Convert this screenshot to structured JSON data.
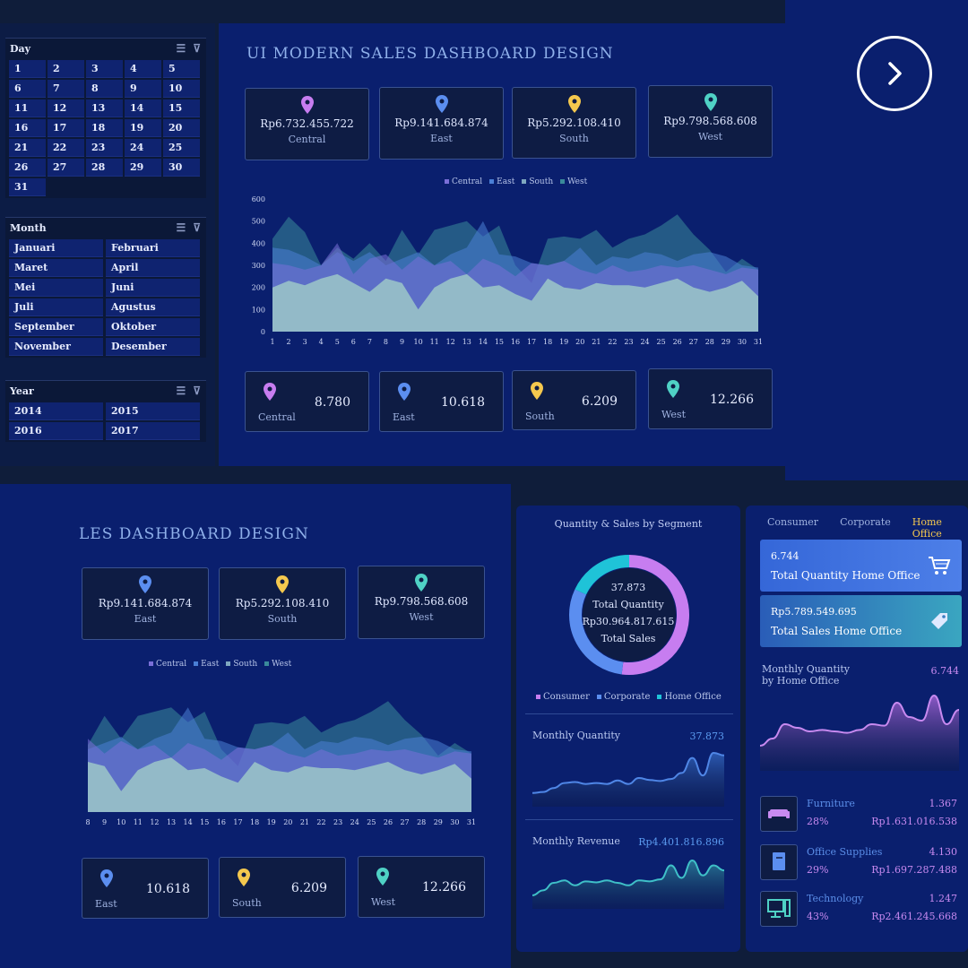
{
  "slicers": {
    "day": {
      "title": "Day",
      "items": [
        "1",
        "2",
        "3",
        "4",
        "5",
        "6",
        "7",
        "8",
        "9",
        "10",
        "11",
        "12",
        "13",
        "14",
        "15",
        "16",
        "17",
        "18",
        "19",
        "20",
        "21",
        "22",
        "23",
        "24",
        "25",
        "26",
        "27",
        "28",
        "29",
        "30",
        "31"
      ]
    },
    "month": {
      "title": "Month",
      "items": [
        "Januari",
        "Februari",
        "Maret",
        "April",
        "Mei",
        "Juni",
        "Juli",
        "Agustus",
        "September",
        "Oktober",
        "November",
        "Desember"
      ]
    },
    "year": {
      "title": "Year",
      "items": [
        "2014",
        "2015",
        "2016",
        "2017"
      ]
    }
  },
  "top": {
    "title": "UI MODERN SALES DASHBOARD DESIGN",
    "sales_cards": [
      {
        "amount": "Rp6.732.455.722",
        "region": "Central",
        "color": "#c77df0"
      },
      {
        "amount": "Rp9.141.684.874",
        "region": "East",
        "color": "#5b8ef0"
      },
      {
        "amount": "Rp5.292.108.410",
        "region": "South",
        "color": "#f4c84e"
      },
      {
        "amount": "Rp9.798.568.608",
        "region": "West",
        "color": "#4fd1c5"
      }
    ],
    "qty_cards": [
      {
        "region": "Central",
        "qty": "8.780",
        "color": "#c77df0"
      },
      {
        "region": "East",
        "qty": "10.618",
        "color": "#5b8ef0"
      },
      {
        "region": "South",
        "qty": "6.209",
        "color": "#f4c84e"
      },
      {
        "region": "West",
        "qty": "12.266",
        "color": "#4fd1c5"
      }
    ]
  },
  "bottom": {
    "title": "LES DASHBOARD DESIGN",
    "sales_cards": [
      {
        "amount": "Rp9.141.684.874",
        "region": "East",
        "color": "#5b8ef0"
      },
      {
        "amount": "Rp5.292.108.410",
        "region": "South",
        "color": "#f4c84e"
      },
      {
        "amount": "Rp9.798.568.608",
        "region": "West",
        "color": "#4fd1c5"
      }
    ],
    "qty_cards": [
      {
        "region": "East",
        "qty": "10.618",
        "color": "#5b8ef0"
      },
      {
        "region": "South",
        "qty": "6.209",
        "color": "#f4c84e"
      },
      {
        "region": "West",
        "qty": "12.266",
        "color": "#4fd1c5"
      }
    ]
  },
  "chart_data": [
    {
      "type": "area",
      "legend": [
        "Central",
        "East",
        "South",
        "West"
      ],
      "x": [
        1,
        2,
        3,
        4,
        5,
        6,
        7,
        8,
        9,
        10,
        11,
        12,
        13,
        14,
        15,
        16,
        17,
        18,
        19,
        20,
        21,
        22,
        23,
        24,
        25,
        26,
        27,
        28,
        29,
        30,
        31
      ],
      "ylim": [
        0,
        600
      ],
      "yticks": [
        0,
        100,
        200,
        300,
        400,
        500,
        600
      ],
      "series": [
        {
          "name": "Central",
          "color": "#7a6fd8",
          "values": [
            310,
            300,
            280,
            300,
            400,
            260,
            330,
            350,
            280,
            340,
            300,
            320,
            260,
            330,
            300,
            250,
            310,
            300,
            320,
            280,
            260,
            300,
            270,
            280,
            300,
            290,
            300,
            280,
            260,
            290,
            280
          ]
        },
        {
          "name": "East",
          "color": "#4a7fd6",
          "values": [
            380,
            370,
            340,
            300,
            360,
            320,
            360,
            300,
            330,
            360,
            300,
            350,
            380,
            500,
            350,
            340,
            310,
            300,
            320,
            380,
            300,
            340,
            330,
            360,
            350,
            320,
            350,
            360,
            340,
            300,
            290
          ]
        },
        {
          "name": "South",
          "color": "#7fa8c0",
          "values": [
            200,
            230,
            210,
            240,
            260,
            220,
            180,
            240,
            220,
            100,
            200,
            240,
            260,
            200,
            210,
            170,
            140,
            240,
            200,
            190,
            220,
            210,
            210,
            200,
            220,
            240,
            200,
            180,
            200,
            230,
            160
          ]
        },
        {
          "name": "West",
          "color": "#3a8a9a",
          "values": [
            420,
            520,
            450,
            300,
            380,
            330,
            400,
            320,
            460,
            350,
            460,
            480,
            500,
            430,
            480,
            300,
            220,
            420,
            430,
            420,
            460,
            380,
            420,
            440,
            480,
            530,
            440,
            370,
            270,
            330,
            280
          ]
        }
      ]
    },
    {
      "type": "pie",
      "title": "Quantity & Sales by Segment",
      "labels": [
        "Consumer",
        "Corporate",
        "Home Office"
      ],
      "colors": [
        "#c77df0",
        "#5b8ef0",
        "#1fc3d8"
      ],
      "values": [
        52,
        30,
        18
      ]
    },
    {
      "type": "area",
      "title": "Monthly Quantity",
      "values": [
        20,
        22,
        30,
        40,
        42,
        38,
        40,
        38,
        45,
        38,
        50,
        46,
        44,
        48,
        60,
        90,
        55,
        100,
        95
      ]
    },
    {
      "type": "area",
      "title": "Monthly Revenue",
      "values": [
        20,
        30,
        45,
        50,
        40,
        48,
        46,
        50,
        45,
        40,
        50,
        48,
        52,
        80,
        55,
        90,
        60,
        80,
        70
      ]
    },
    {
      "type": "area",
      "title": "Monthly Quantity by Home Office",
      "values": [
        30,
        40,
        60,
        55,
        50,
        52,
        50,
        48,
        52,
        60,
        58,
        90,
        70,
        65,
        100,
        60,
        80
      ]
    }
  ],
  "mid": {
    "title": "Quantity & Sales by Segment",
    "total_qty_value": "37.873",
    "total_qty_label": "Total Quantity",
    "total_sales_value": "Rp30.964.817.615",
    "total_sales_label": "Total Sales",
    "legend": [
      "Consumer",
      "Corporate",
      "Home Office"
    ],
    "monthly_quantity_label": "Monthly Quantity",
    "monthly_quantity_value": "37.873",
    "monthly_revenue_label": "Monthly Revenue",
    "monthly_revenue_value": "Rp4.401.816.896"
  },
  "right": {
    "tabs": [
      "Consumer",
      "Corporate",
      "Home Office"
    ],
    "qty_box_value": "6.744",
    "qty_box_label": "Total Quantity Home Office",
    "sales_box_value": "Rp5.789.549.695",
    "sales_box_label": "Total Sales Home Office",
    "monthly_label_1": "Monthly Quantity",
    "monthly_label_2": "by  Home Office",
    "monthly_value": "6.744",
    "categories": [
      {
        "name": "Furniture",
        "pct": "28%",
        "qty": "1.367",
        "sales": "Rp1.631.016.538",
        "icon": "sofa-icon"
      },
      {
        "name": "Office Supplies",
        "pct": "29%",
        "qty": "4.130",
        "sales": "Rp1.697.287.488",
        "icon": "book-icon"
      },
      {
        "name": "Technology",
        "pct": "43%",
        "qty": "1.247",
        "sales": "Rp2.461.245.668",
        "icon": "computer-icon"
      }
    ]
  }
}
